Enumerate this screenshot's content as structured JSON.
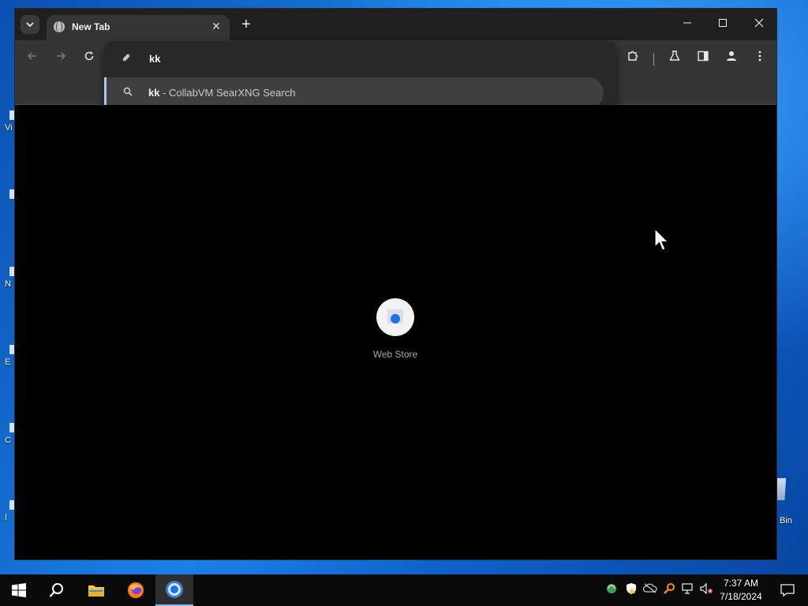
{
  "browser": {
    "tab": {
      "title": "New Tab",
      "favicon": "globe-icon"
    },
    "controls": {
      "minimize": "—",
      "maximize": "☐",
      "close": "✕",
      "new_tab": "+",
      "tab_close": "✕"
    },
    "omnibox": {
      "input_value": "kk",
      "suggestion_query": "kk",
      "suggestion_suffix": " - CollabVM SearXNG Search"
    }
  },
  "new_tab_page": {
    "shortcuts": [
      {
        "label": "Web Store",
        "icon": "web-store-icon"
      }
    ]
  },
  "desktop": {
    "recycle_bin_label": "Bin",
    "icon_labels": [
      "Vi",
      "",
      "N",
      "E",
      "C",
      "I"
    ]
  },
  "taskbar": {
    "clock_time": "7:37 AM",
    "clock_date": "7/18/2024",
    "apps": [
      "start-icon",
      "search-icon",
      "file-explorer-icon",
      "firefox-icon",
      "chrome-icon"
    ]
  },
  "colors": {
    "accent": "#a8c7fa",
    "tab_bg": "#353535",
    "titlebar": "#1f1f1f"
  }
}
